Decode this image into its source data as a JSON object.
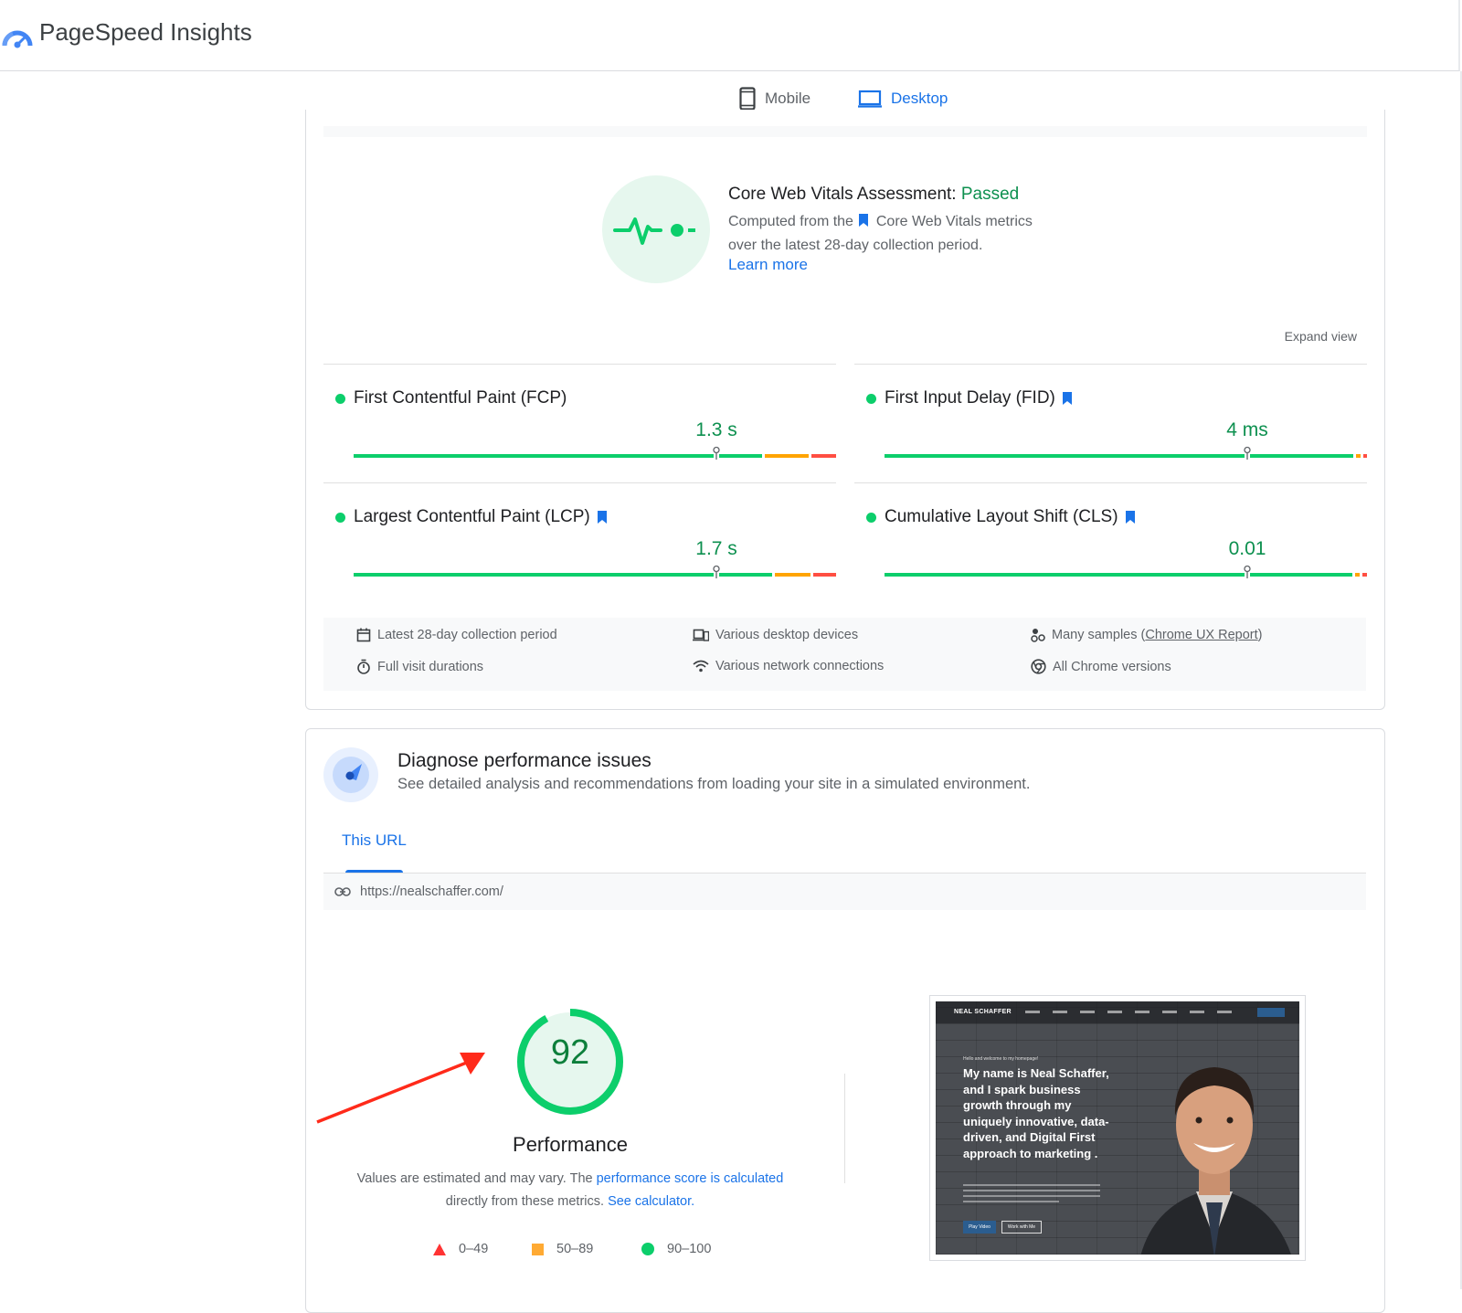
{
  "app": {
    "title": "PageSpeed Insights"
  },
  "device_tabs": [
    {
      "label": "Mobile",
      "icon": "smartphone-icon",
      "active": false
    },
    {
      "label": "Desktop",
      "icon": "laptop-icon",
      "active": true
    }
  ],
  "cwv": {
    "title_prefix": "Core Web Vitals Assessment: ",
    "status": "Passed",
    "desc_part1": "Computed from the",
    "desc_part2": "Core Web Vitals metrics",
    "desc_line2": "over the latest 28-day collection period.",
    "learn_more": "Learn more",
    "expand_view": "Expand view",
    "metrics": [
      {
        "label": "First Contentful Paint (FCP)",
        "value": "1.3 s",
        "core": false,
        "marker_fraction": 0.752,
        "good_fraction": 0.852,
        "ni_fraction": 0.948
      },
      {
        "label": "First Input Delay (FID)",
        "value": "4 ms",
        "core": true,
        "marker_fraction": 0.752,
        "good_fraction": 0.978,
        "ni_fraction": 0.992
      },
      {
        "label": "Largest Contentful Paint (LCP)",
        "value": "1.7 s",
        "core": true,
        "marker_fraction": 0.752,
        "good_fraction": 0.873,
        "ni_fraction": 0.953
      },
      {
        "label": "Cumulative Layout Shift (CLS)",
        "value": "0.01",
        "core": true,
        "marker_fraction": 0.752,
        "good_fraction": 0.976,
        "ni_fraction": 0.99
      }
    ],
    "info": {
      "period": "Latest 28-day collection period",
      "devices": "Various desktop devices",
      "samples_prefix": "Many samples (",
      "samples_link": "Chrome UX Report",
      "samples_suffix": ")",
      "durations": "Full visit durations",
      "network": "Various network connections",
      "versions": "All Chrome versions"
    }
  },
  "diagnose": {
    "title": "Diagnose performance issues",
    "subtitle": "See detailed analysis and recommendations from loading your site in a simulated environment.",
    "tab": "This URL",
    "url": "https://nealschaffer.com/",
    "score": "92",
    "score_fraction": 0.92,
    "score_label": "Performance",
    "note_part1": "Values are estimated and may vary. The ",
    "note_link1": "performance score is calculated",
    "note_part2": "directly from these metrics. ",
    "note_link2": "See calculator.",
    "legend": [
      {
        "range": "0–49",
        "color": "#ff3333"
      },
      {
        "range": "50–89",
        "color": "#ffaa33"
      },
      {
        "range": "90–100",
        "color": "#0cce6b"
      }
    ],
    "screenshot": {
      "logo": "NEAL SCHAFFER",
      "small": "Hello and welcome to my homepage!",
      "headline": "My name is Neal Schaffer, and I spark business growth through my uniquely innovative, data-driven, and Digital First approach to marketing .",
      "btn1": "Play Video",
      "btn2": "Work with Me"
    }
  },
  "colors": {
    "accent": "#1a73e8",
    "good": "#0cce6b",
    "good_text": "#0d904f",
    "average": "#ffa400",
    "poor": "#ff4e42"
  }
}
